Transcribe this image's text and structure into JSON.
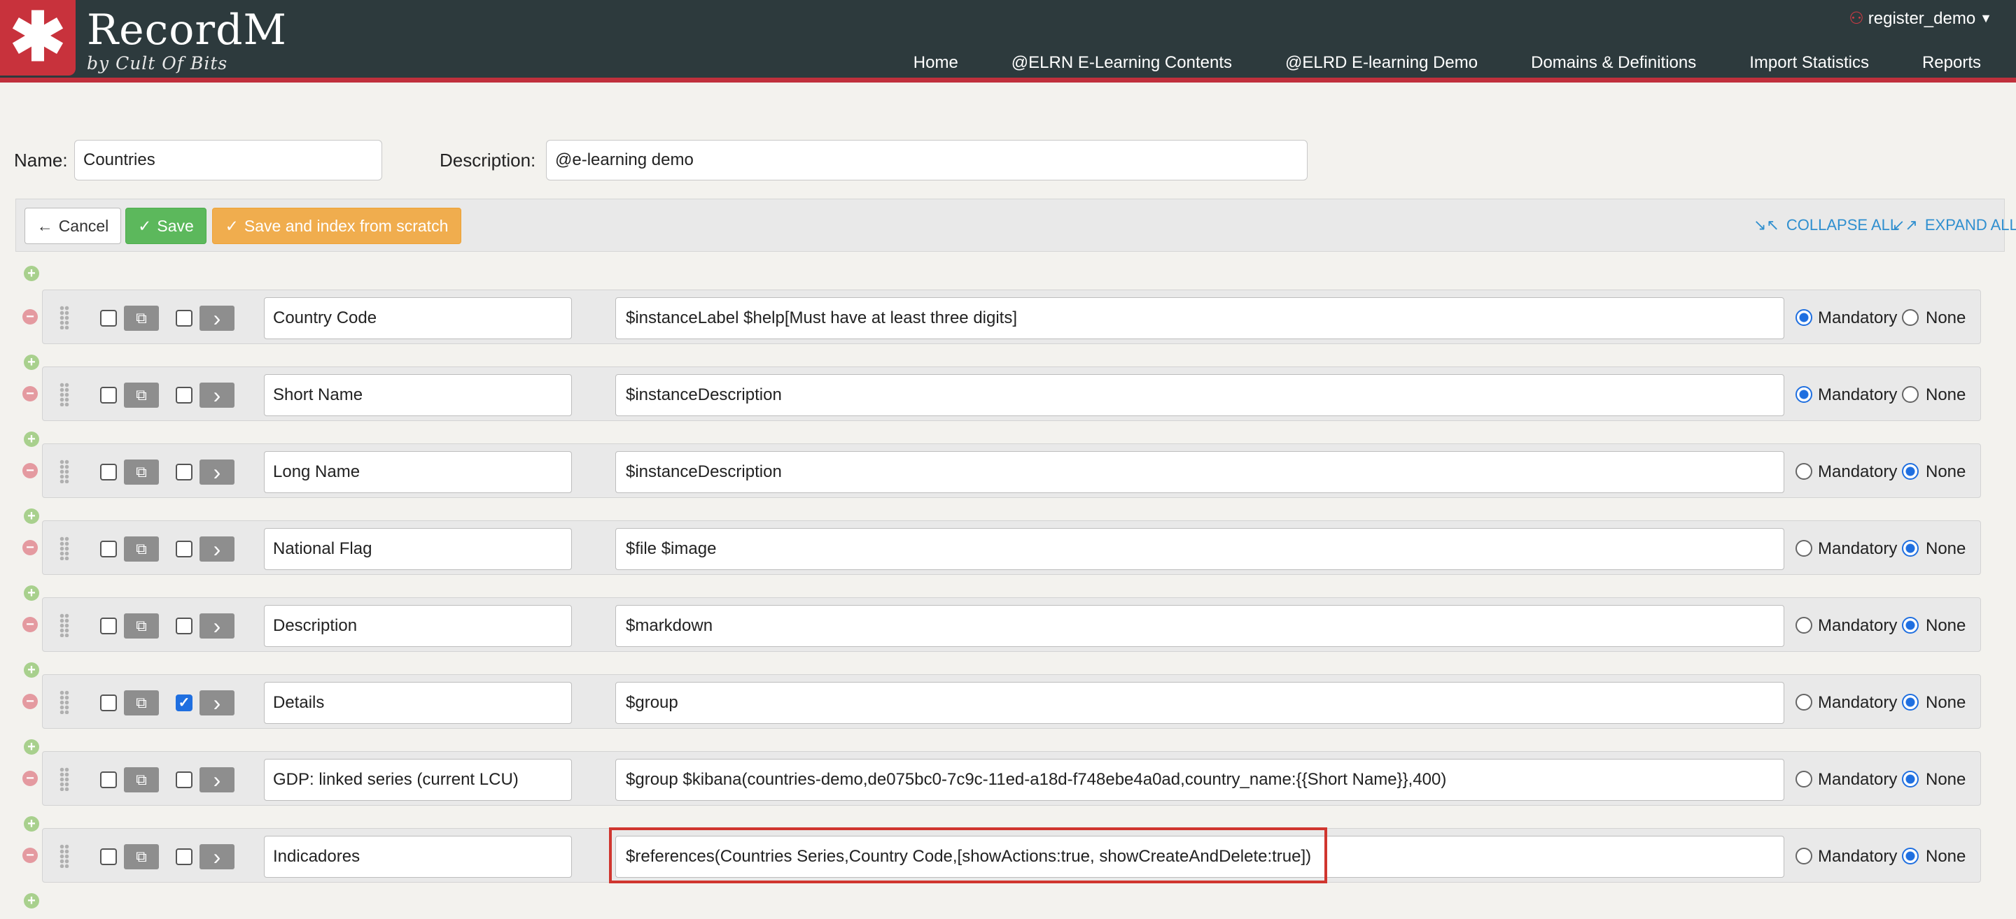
{
  "header": {
    "brand_symbol": "✱",
    "brand_title": "RecordM",
    "brand_subtitle": "by Cult Of Bits",
    "user": "register_demo",
    "nav": [
      "Home",
      "@ELRN E-Learning Contents",
      "@ELRD E-learning Demo",
      "Domains & Definitions",
      "Import Statistics",
      "Reports"
    ],
    "accent_color": "#c8323c",
    "bar_color": "#2d3a3d"
  },
  "form": {
    "name_label": "Name:",
    "name_value": "Countries",
    "description_label": "Description:",
    "description_value": "@e-learning demo"
  },
  "toolbar": {
    "cancel_label": "Cancel",
    "save_label": "Save",
    "save_index_label": "Save and index from scratch",
    "collapse_label": "COLLAPSE ALL",
    "expand_label": "EXPAND ALL"
  },
  "field_labels": {
    "mandatory": "Mandatory",
    "none": "None"
  },
  "fields": [
    {
      "name": "Country Code",
      "description": "$instanceLabel $help[Must have at least three digits]",
      "checked": false,
      "mandatory": true
    },
    {
      "name": "Short Name",
      "description": "$instanceDescription",
      "checked": false,
      "mandatory": true
    },
    {
      "name": "Long Name",
      "description": "$instanceDescription",
      "checked": false,
      "mandatory": false
    },
    {
      "name": "National Flag",
      "description": "$file $image",
      "checked": false,
      "mandatory": false
    },
    {
      "name": "Description",
      "description": "$markdown",
      "checked": false,
      "mandatory": false
    },
    {
      "name": "Details",
      "description": "$group",
      "checked": true,
      "mandatory": false
    },
    {
      "name": "GDP: linked series (current LCU)",
      "description": "$group $kibana(countries-demo,de075bc0-7c9c-11ed-a18d-f748ebe4a0ad,country_name:{{Short Name}},400)",
      "checked": false,
      "mandatory": false
    },
    {
      "name": "Indicadores",
      "description": "$references(Countries Series,Country Code,[showActions:true, showCreateAndDelete:true])",
      "checked": false,
      "mandatory": false,
      "highlighted": true
    }
  ]
}
